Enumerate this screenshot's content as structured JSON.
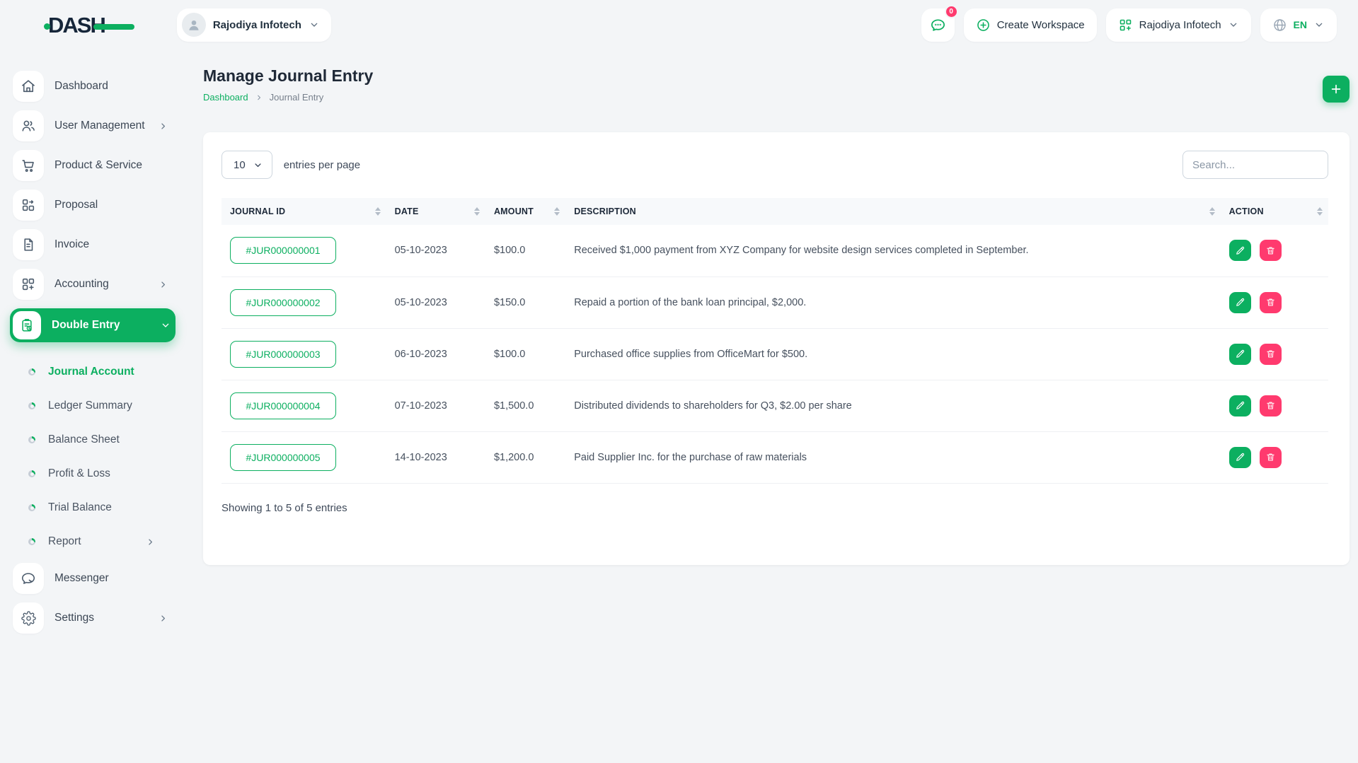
{
  "colors": {
    "primary": "#0caf60",
    "danger": "#ff3a6e",
    "logo_dark": "#16263a"
  },
  "brand": {
    "name": "DASH"
  },
  "topbar": {
    "workspace": {
      "name": "Rajodiya Infotech"
    },
    "chat_badge": "0",
    "create_workspace_label": "Create Workspace",
    "company_name": "Rajodiya Infotech",
    "language": "EN"
  },
  "sidebar": {
    "items": [
      {
        "label": "Dashboard",
        "icon": "home-icon",
        "chevron": null,
        "active": false
      },
      {
        "label": "User Management",
        "icon": "users-icon",
        "chevron": "right",
        "active": false
      },
      {
        "label": "Product & Service",
        "icon": "cart-icon",
        "chevron": null,
        "active": false
      },
      {
        "label": "Proposal",
        "icon": "proposal-icon",
        "chevron": null,
        "active": false
      },
      {
        "label": "Invoice",
        "icon": "invoice-icon",
        "chevron": null,
        "active": false
      },
      {
        "label": "Accounting",
        "icon": "accounting-icon",
        "chevron": "right",
        "active": false
      },
      {
        "label": "Double Entry",
        "icon": "double-entry-icon",
        "chevron": "down",
        "active": true
      }
    ],
    "sub_items": [
      {
        "label": "Journal Account",
        "active": true,
        "chevron": null
      },
      {
        "label": "Ledger Summary",
        "active": false,
        "chevron": null
      },
      {
        "label": "Balance Sheet",
        "active": false,
        "chevron": null
      },
      {
        "label": "Profit & Loss",
        "active": false,
        "chevron": null
      },
      {
        "label": "Trial Balance",
        "active": false,
        "chevron": null
      },
      {
        "label": "Report",
        "active": false,
        "chevron": "right"
      }
    ],
    "bottom_items": [
      {
        "label": "Messenger",
        "icon": "messenger-icon",
        "chevron": null,
        "active": false
      },
      {
        "label": "Settings",
        "icon": "settings-icon",
        "chevron": "right",
        "active": false
      }
    ]
  },
  "page": {
    "title": "Manage Journal Entry",
    "breadcrumb": {
      "root": "Dashboard",
      "current": "Journal Entry"
    }
  },
  "table": {
    "page_size": "10",
    "page_size_label": "entries per page",
    "search_placeholder": "Search...",
    "columns": [
      "JOURNAL ID",
      "DATE",
      "AMOUNT",
      "DESCRIPTION",
      "ACTION"
    ],
    "rows": [
      {
        "journal_id": "#JUR000000001",
        "date": "05-10-2023",
        "amount": "$100.0",
        "description": "Received $1,000 payment from XYZ Company for website design services completed in September."
      },
      {
        "journal_id": "#JUR000000002",
        "date": "05-10-2023",
        "amount": "$150.0",
        "description": "Repaid a portion of the bank loan principal, $2,000."
      },
      {
        "journal_id": "#JUR000000003",
        "date": "06-10-2023",
        "amount": "$100.0",
        "description": "Purchased office supplies from OfficeMart for $500."
      },
      {
        "journal_id": "#JUR000000004",
        "date": "07-10-2023",
        "amount": "$1,500.0",
        "description": "Distributed dividends to shareholders for Q3, $2.00 per share"
      },
      {
        "journal_id": "#JUR000000005",
        "date": "14-10-2023",
        "amount": "$1,200.0",
        "description": "Paid Supplier Inc. for the purchase of raw materials"
      }
    ],
    "footer": "Showing 1 to 5 of 5 entries"
  }
}
